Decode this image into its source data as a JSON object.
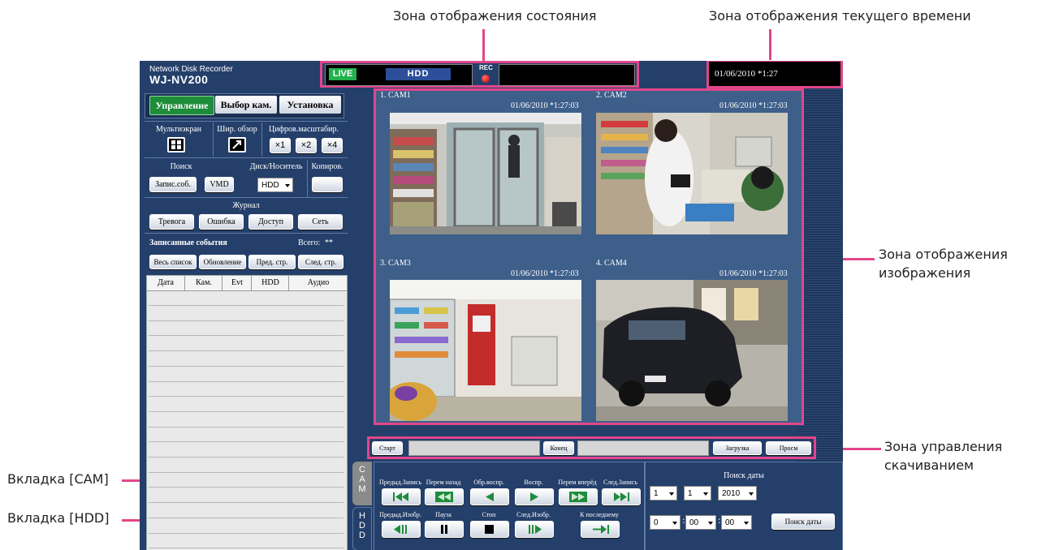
{
  "callouts": {
    "status_zone": "Зона отображения состояния",
    "time_zone": "Зона отображения текущего времени",
    "image_zone_line1": "Зона отображения",
    "image_zone_line2": "изображения",
    "download_zone_line1": "Зона управления",
    "download_zone_line2": "скачиванием",
    "cam_tab": "Вкладка [CAM]",
    "hdd_tab": "Вкладка [HDD]"
  },
  "brand": {
    "line1": "Network Disk Recorder",
    "line2": "WJ-NV200"
  },
  "status": {
    "live": "LIVE",
    "hdd": "HDD",
    "rec": "REC",
    "status_text": ""
  },
  "clock": "01/06/2010  *1:27",
  "tabs": [
    "Управление",
    "Выбор кам.",
    "Установка"
  ],
  "controls": {
    "multiscreen": "Мультиэкран",
    "wide_view": "Шир. обзор",
    "digital_zoom": "Цифров.масштабир.",
    "zoom": [
      "×1",
      "×2",
      "×4"
    ],
    "search": "Поиск",
    "disk": "Диск/Носитель",
    "copy": "Копиров.",
    "rec_events_btn": "Запис.соб.",
    "vmd_btn": "VMD",
    "disk_select": "HDD",
    "journal": "Журнал",
    "journal_btns": [
      "Тревога",
      "Ошибка",
      "Доступ",
      "Сеть"
    ]
  },
  "events": {
    "title": "Записанные события",
    "total_label": "Всего:",
    "total": "**",
    "buttons": [
      "Весь список",
      "Обновление",
      "Пред. стр.",
      "След. стр."
    ],
    "columns": [
      "Дата",
      "Кам.",
      "Evt",
      "HDD",
      "Аудио"
    ],
    "row_count": 17
  },
  "cameras": [
    {
      "name": "1. CAM1",
      "time": "01/06/2010  *1:27:03",
      "scene": "door"
    },
    {
      "name": "2. CAM2",
      "time": "01/06/2010  *1:27:03",
      "scene": "cashier"
    },
    {
      "name": "3. CAM3",
      "time": "01/06/2010  *1:27:03",
      "scene": "store"
    },
    {
      "name": "4. CAM4",
      "time": "01/06/2010  *1:27:03",
      "scene": "car"
    }
  ],
  "download": {
    "start": "Старт",
    "end": "Конец",
    "load": "Загрузка",
    "browse": "Просм",
    "start_value": "",
    "end_value": ""
  },
  "side_tabs": {
    "cam": "CAM",
    "hdd": "HDD"
  },
  "playback": {
    "row1": [
      "Предыд.Запись",
      "Перем назад",
      "Обр.воспр.",
      "Воспр.",
      "Перем вперёд",
      "След.Запись"
    ],
    "row2": [
      "Предыд.Изобр.",
      "Пауза",
      "Стоп",
      "След.Изобр.",
      "К последнему"
    ]
  },
  "date_search": {
    "title": "Поиск даты",
    "month": "1",
    "day": "1",
    "year": "2010",
    "hour": "0",
    "minute": "00",
    "second": "00",
    "button": "Поиск даты"
  },
  "colors": {
    "live_green": "#22b14c",
    "hdd_blue": "#2d4f9a",
    "accent_pink": "#e2468a",
    "app_blue": "#243f6a",
    "active_tab": "#1e8c3a"
  }
}
